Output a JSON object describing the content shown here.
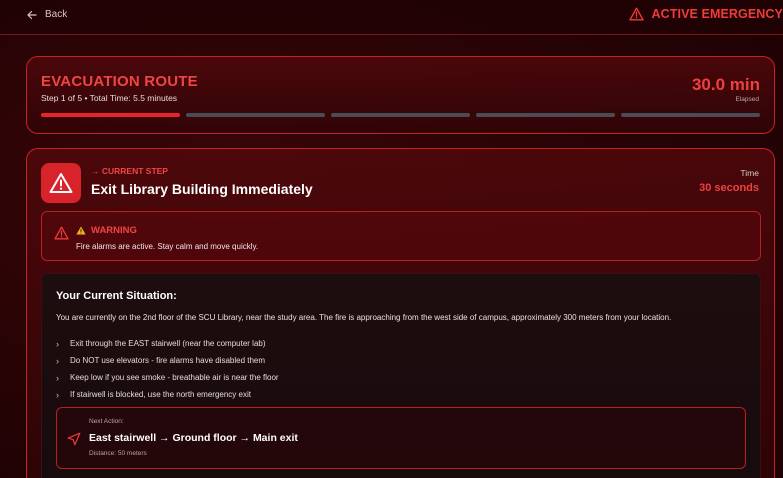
{
  "header": {
    "back_label": "Back",
    "emergency_label": "ACTIVE EMERGENCY"
  },
  "route": {
    "title": "EVACUATION ROUTE",
    "subtitle": "Step 1 of 5 • Total Time: 5.5 minutes",
    "elapsed_value": "30.0 min",
    "elapsed_label": "Elapsed",
    "progress": {
      "current_step": 1,
      "total_steps": 5
    }
  },
  "step": {
    "label": "→ CURRENT STEP",
    "title": "Exit Library Building Immediately",
    "time_label": "Time",
    "time_value": "30 seconds"
  },
  "warning": {
    "title": "WARNING",
    "text": "Fire alarms are active. Stay calm and move quickly."
  },
  "situation": {
    "title": "Your Current Situation:",
    "description": "You are currently on the 2nd floor of the SCU Library, near the study area. The fire is approaching from the west side of campus, approximately 300 meters from your location.",
    "bullets": [
      "Exit through the EAST stairwell (near the computer lab)",
      "Do NOT use elevators - fire alarms have disabled them",
      "Keep low if you see smoke - breathable air is near the floor",
      "If stairwell is blocked, use the north emergency exit"
    ]
  },
  "next_action": {
    "label": "Next Action:",
    "route": "East stairwell → Ground floor → Main exit",
    "distance": "Distance: 50 meters"
  },
  "colors": {
    "accent": "#ef4040",
    "danger_fill": "#d9232a",
    "border": "#c62127",
    "inactive_segment": "#4a4b57"
  }
}
